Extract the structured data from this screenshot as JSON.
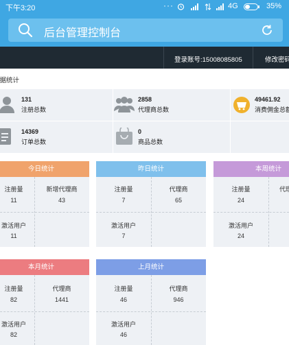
{
  "status": {
    "time": "下午3:20",
    "dots": "···",
    "network": "4G",
    "battery": "35%"
  },
  "search": {
    "title": "后台管理控制台"
  },
  "header": {
    "login_label": "登录账号:15008085805",
    "change_password": "修改密码"
  },
  "section": {
    "title": "数据统计"
  },
  "summary": {
    "registered": {
      "value": "131",
      "label": "注册总数"
    },
    "agents": {
      "value": "2858",
      "label": "代理商总数"
    },
    "commission": {
      "value": "49461.92",
      "label": "消费佣金总额"
    },
    "orders": {
      "value": "14369",
      "label": "订单总数"
    },
    "products": {
      "value": "0",
      "label": "商品总数"
    }
  },
  "cards": {
    "today": {
      "title": "今日统计",
      "color": "#f0a36c",
      "l1": "注册量",
      "v1": "11",
      "l2": "新增代理商",
      "v2": "43",
      "l3": "激活用户",
      "v3": "11"
    },
    "yesterday": {
      "title": "昨日统计",
      "color": "#7fc0ec",
      "l1": "注册量",
      "v1": "7",
      "l2": "代理商",
      "v2": "65",
      "l3": "激活用户",
      "v3": "7"
    },
    "week": {
      "title": "本周统计",
      "color": "#c59ad9",
      "l1": "注册量",
      "v1": "24",
      "l2": "代理商",
      "v2": "",
      "l3": "激活用户",
      "v3": "24"
    },
    "month": {
      "title": "本月统计",
      "color": "#ec7c80",
      "l1": "注册量",
      "v1": "82",
      "l2": "代理商",
      "v2": "1441",
      "l3": "激活用户",
      "v3": "82"
    },
    "lastmonth": {
      "title": "上月统计",
      "color": "#7d9ee6",
      "l1": "注册量",
      "v1": "46",
      "l2": "代理商",
      "v2": "946",
      "l3": "激活用户",
      "v3": "46"
    }
  }
}
